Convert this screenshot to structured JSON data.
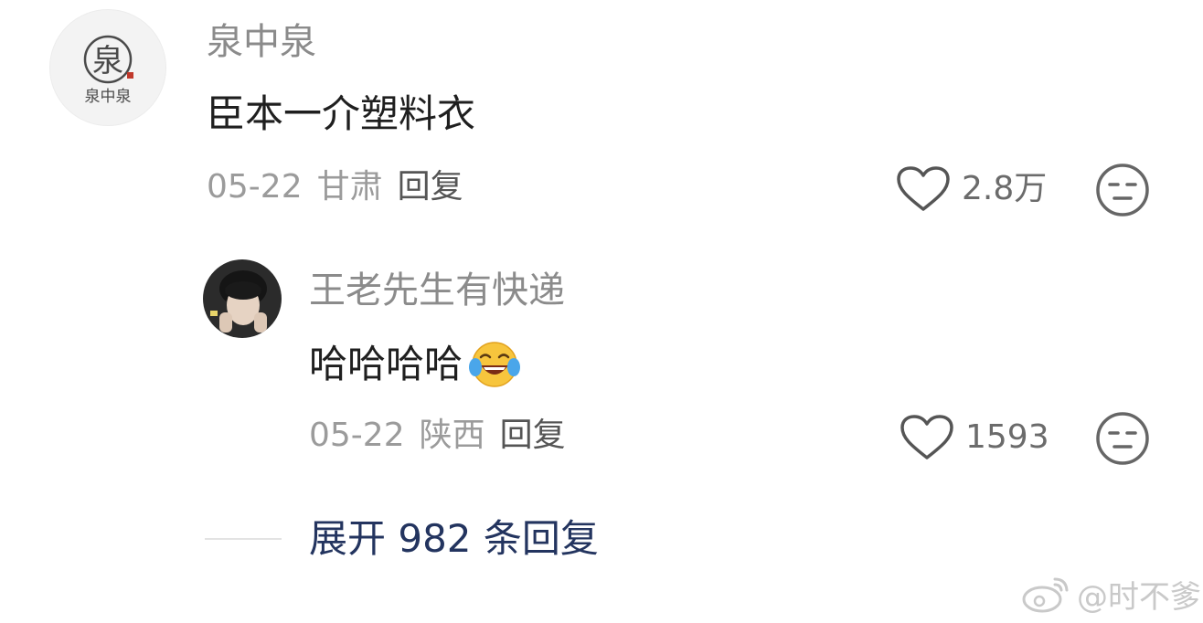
{
  "main_comment": {
    "username": "泉中泉",
    "avatar_text": "泉中泉",
    "avatar_glyph": "泉",
    "text": "臣本一介塑料衣",
    "date": "05-22",
    "location": "甘肃",
    "reply_label": "回复",
    "like_count": "2.8万",
    "like_icon": "heart-outline-icon",
    "dislike_icon": "meh-face-icon"
  },
  "reply_comment": {
    "username": "王老先生有快递",
    "text": "哈哈哈哈",
    "emoji": "tears-of-joy-emoji",
    "date": "05-22",
    "location": "陕西",
    "reply_label": "回复",
    "like_count": "1593",
    "like_icon": "heart-outline-icon",
    "dislike_icon": "meh-face-icon"
  },
  "expand": {
    "label": "展开 982 条回复"
  },
  "watermark": {
    "text": "@时不爹",
    "icon": "weibo-icon"
  },
  "colors": {
    "username": "#8b8b8b",
    "body_text": "#1f1f1f",
    "meta": "#9b9b9b",
    "expand_link": "#23345f",
    "seal_red": "#c0392b"
  }
}
